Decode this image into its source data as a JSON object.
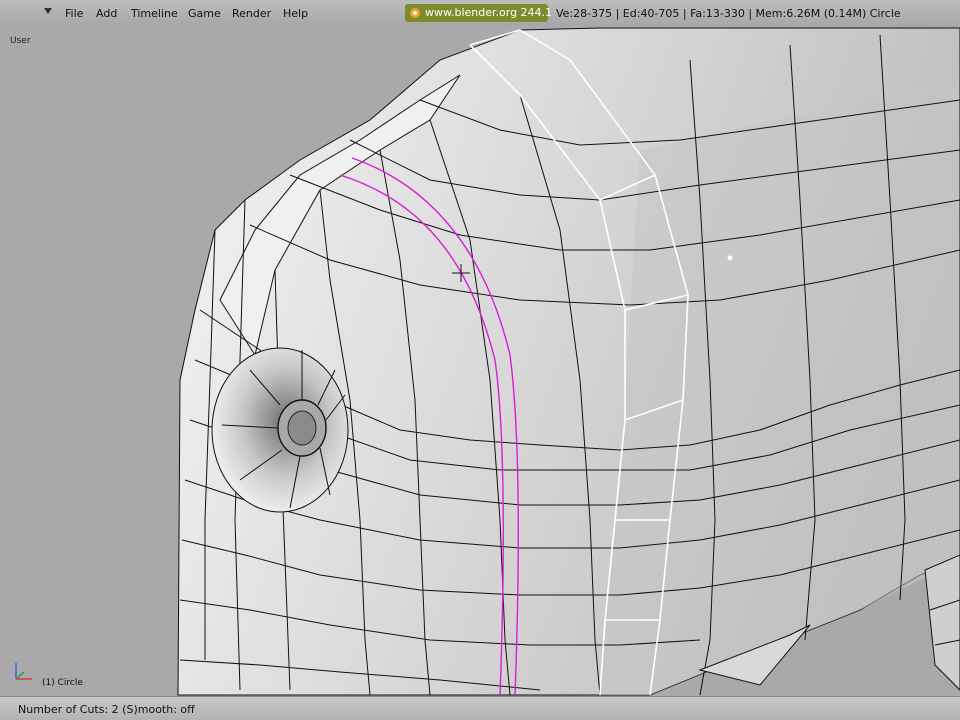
{
  "menubar": {
    "items": [
      "File",
      "Add",
      "Timeline",
      "Game",
      "Render",
      "Help"
    ]
  },
  "header": {
    "url": "www.blender.org 244.1",
    "stats": "Ve:28-375 | Ed:40-705 | Fa:13-330 | Mem:6.26M (0.14M) Circle"
  },
  "viewport": {
    "view_name": "User",
    "active_object": "(1) Circle"
  },
  "status": {
    "text": "Number of Cuts: 2 (S)mooth: off"
  },
  "colors": {
    "background": "#a9a9a9",
    "mesh": "#e4e4e4",
    "wire": "#111111",
    "selected_edge": "#ffffff",
    "loop_cut_preview": "#d81fd8",
    "url_badge": "#7c8c2d"
  },
  "icons": [
    "menu-toggle-icon",
    "blender-logo-icon",
    "axis-icon",
    "crosshair-cursor-icon"
  ]
}
